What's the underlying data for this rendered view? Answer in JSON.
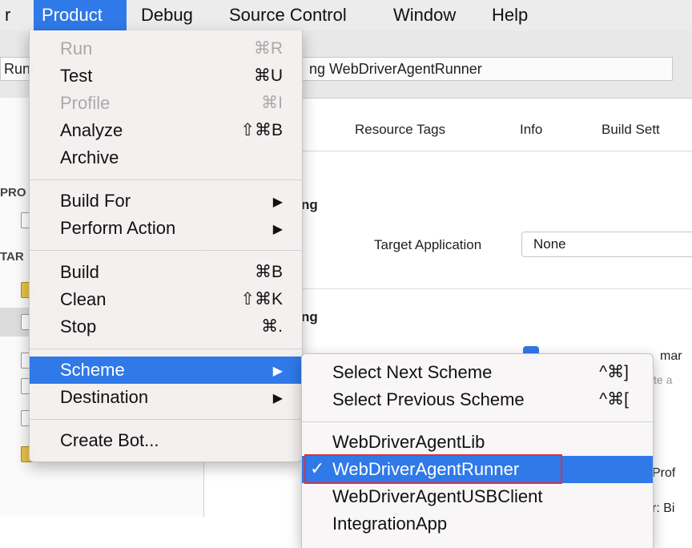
{
  "menubar": {
    "items": [
      {
        "label": "r"
      },
      {
        "label": "Product"
      },
      {
        "label": "Debug"
      },
      {
        "label": "Source Control"
      },
      {
        "label": "Window"
      },
      {
        "label": "Help"
      }
    ]
  },
  "toolbar": {
    "scheme_left": "Runi",
    "scheme_right": "ng WebDriverAgentRunner"
  },
  "sidebar": {
    "labels": [
      "PRO",
      "TAR"
    ]
  },
  "editor": {
    "tabs": [
      "Resource Tags",
      "Info",
      "Build Sett"
    ],
    "section1_title": "ng",
    "target_app_label": "Target Application",
    "target_app_value": "None",
    "section2_title": "ng",
    "ghost1": "mar",
    "ghost2": "te a",
    "ghost3": "Prof",
    "ghost4": "r: Bi"
  },
  "product_menu": {
    "items": [
      {
        "label": "Run",
        "shortcut": "⌘R",
        "disabled": true
      },
      {
        "label": "Test",
        "shortcut": "⌘U"
      },
      {
        "label": "Profile",
        "shortcut": "⌘I",
        "disabled": true
      },
      {
        "label": "Analyze",
        "shortcut": "⇧⌘B"
      },
      {
        "label": "Archive",
        "shortcut": ""
      },
      {
        "label": "Build For",
        "submenu": true
      },
      {
        "label": "Perform Action",
        "submenu": true
      },
      {
        "label": "Build",
        "shortcut": "⌘B"
      },
      {
        "label": "Clean",
        "shortcut": "⇧⌘K"
      },
      {
        "label": "Stop",
        "shortcut": "⌘."
      },
      {
        "label": "Scheme",
        "submenu": true,
        "highlighted": true
      },
      {
        "label": "Destination",
        "submenu": true
      },
      {
        "label": "Create Bot...",
        "shortcut": ""
      }
    ],
    "arrow": "▶"
  },
  "scheme_submenu": {
    "items": [
      {
        "label": "Select Next Scheme",
        "shortcut": "^⌘]"
      },
      {
        "label": "Select Previous Scheme",
        "shortcut": "^⌘["
      },
      {
        "label": "WebDriverAgentLib"
      },
      {
        "label": "WebDriverAgentRunner",
        "checked": true,
        "highlighted": true
      },
      {
        "label": "WebDriverAgentUSBClient"
      },
      {
        "label": "IntegrationApp"
      }
    ],
    "check": "✓"
  },
  "colors": {
    "accent": "#2f79e8",
    "annotation": "#e0303b"
  }
}
